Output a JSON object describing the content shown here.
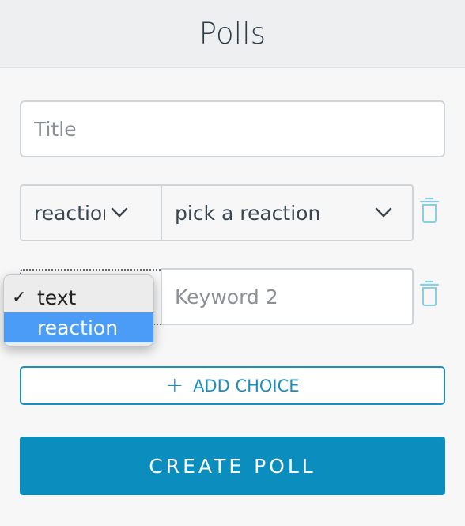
{
  "header": {
    "title": "Polls"
  },
  "form": {
    "title_placeholder": "Title",
    "choices": [
      {
        "type_value": "reaction",
        "value": "pick a reaction"
      },
      {
        "type_value": "text",
        "value_placeholder": "Keyword 2"
      }
    ],
    "type_dropdown": {
      "options": [
        "text",
        "reaction"
      ],
      "selected": "text",
      "highlighted": "reaction",
      "check_glyph": "✓"
    },
    "add_choice_label": "ADD CHOICE",
    "create_poll_label": "CREATE POLL"
  },
  "colors": {
    "accent": "#0b8dbe",
    "highlight": "#4a9cf6",
    "trash": "#86cfe6"
  },
  "icons": [
    "chevron-down-icon",
    "trash-icon",
    "plus-icon",
    "check-icon"
  ]
}
